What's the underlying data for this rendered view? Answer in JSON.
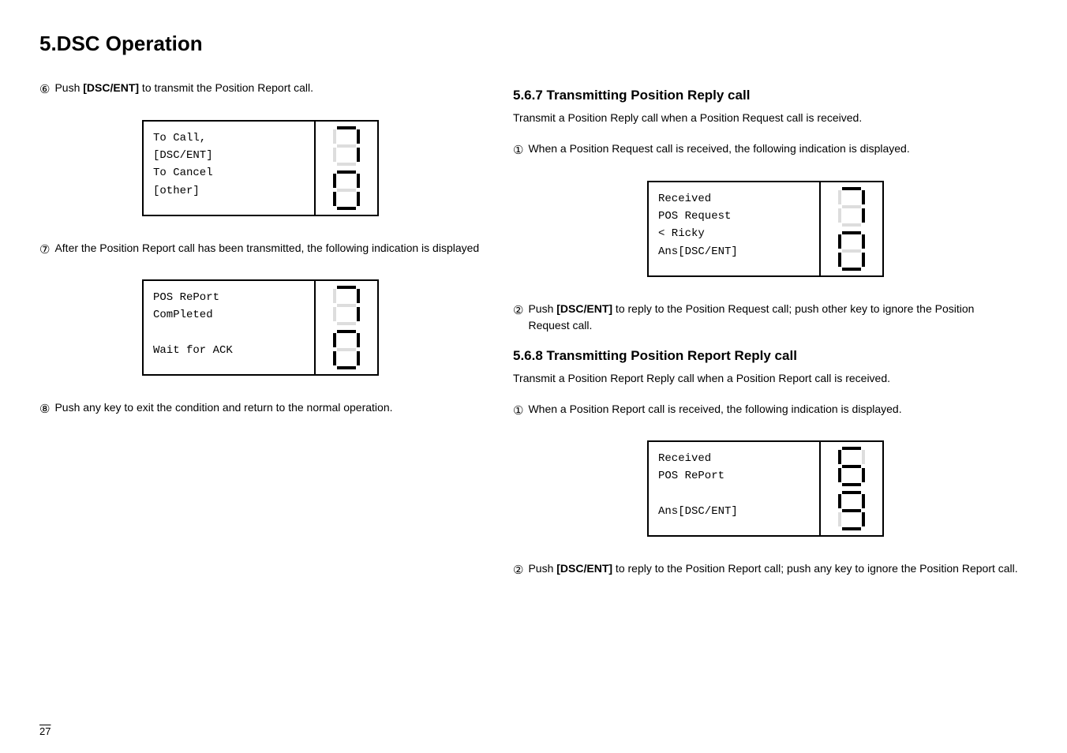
{
  "page": {
    "title": "5.DSC Operation",
    "page_number": "27"
  },
  "left_column": {
    "step6": {
      "circle": "6",
      "text_before": "Push ",
      "bold": "[DSC/ENT]",
      "text_after": " to transmit the Position Report call."
    },
    "display1": {
      "lines": [
        "To Call,",
        "[DSC/ENT]",
        "To Cancel",
        "[other]"
      ],
      "digits": [
        "7",
        "0"
      ]
    },
    "step7": {
      "circle": "7",
      "text": "After the Position Report call has been transmitted, the following indication is displayed"
    },
    "display2": {
      "lines": [
        "POS RePort",
        "ComPleted",
        "",
        "Wait for ACK"
      ],
      "digits": [
        "7",
        "0"
      ]
    },
    "step8": {
      "circle": "8",
      "text": "Push any key to exit the condition and return to the normal operation."
    }
  },
  "right_column": {
    "section567": {
      "title": "5.6.7 Transmitting Position Reply call",
      "body": "Transmit a Position Reply call when a Position Request call is received."
    },
    "step567_1": {
      "circle": "1",
      "text": "When a Position Request call is received, the following indication is displayed."
    },
    "display567": {
      "lines": [
        "Received",
        "POS Request",
        "< Ricky",
        "Ans[DSC/ENT]"
      ],
      "digits": [
        "7",
        "0"
      ]
    },
    "step567_2": {
      "circle": "2",
      "text_before": "Push ",
      "bold": "[DSC/ENT]",
      "text_after": " to reply to the Position Request call; push other key to ignore the Position Request call."
    },
    "section568": {
      "title": "5.6.8 Transmitting Position Report Reply call",
      "body": "Transmit a Position Report Reply call when a Position Report call is received."
    },
    "step568_1": {
      "circle": "1",
      "text": "When a Position Report call is received, the following indication is displayed."
    },
    "display568": {
      "lines": [
        "Received",
        "POS RePort",
        "",
        "Ans[DSC/ENT]"
      ],
      "digits": [
        "6",
        "9"
      ]
    },
    "step568_2": {
      "circle": "2",
      "text_before": "Push ",
      "bold": "[DSC/ENT]",
      "text_after": " to reply to the Position Report call; push any key to ignore the Position Report call."
    }
  }
}
